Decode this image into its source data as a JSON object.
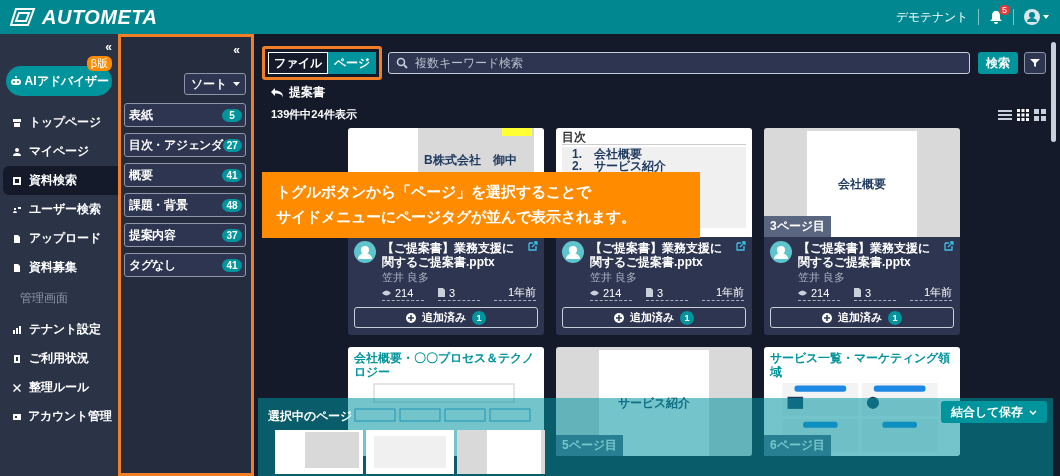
{
  "header": {
    "logo": "AUTOMETA",
    "tenant": "デモテナント",
    "notification_count": "5"
  },
  "sidebar": {
    "collapse": "«",
    "ai_button": "AIアドバイザー",
    "ai_badge": "β版",
    "items": [
      {
        "label": "トップページ",
        "selected": false
      },
      {
        "label": "マイページ",
        "selected": false
      },
      {
        "label": "資料検索",
        "selected": true
      },
      {
        "label": "ユーザー検索",
        "selected": false
      },
      {
        "label": "アップロード",
        "selected": false
      },
      {
        "label": "資料募集",
        "selected": false
      }
    ],
    "section": "管理画面",
    "admin_items": [
      {
        "label": "テナント設定",
        "selected": false
      },
      {
        "label": "ご利用状況",
        "selected": false
      },
      {
        "label": "整理ルール",
        "selected": false
      },
      {
        "label": "アカウント管理",
        "selected": false
      }
    ]
  },
  "tag_panel": {
    "annotated": true,
    "collapse": "«",
    "sort": "ソート",
    "tags": [
      {
        "label": "表紙",
        "count": "5"
      },
      {
        "label": "目次・アジェンダ",
        "count": "27"
      },
      {
        "label": "概要",
        "count": "41"
      },
      {
        "label": "課題・背景",
        "count": "48"
      },
      {
        "label": "提案内容",
        "count": "37"
      },
      {
        "label": "タグなし",
        "count": "41"
      }
    ]
  },
  "toolbar": {
    "annotated": true,
    "toggle": [
      {
        "label": "ファイル",
        "selected": false
      },
      {
        "label": "ページ",
        "selected": true
      }
    ],
    "search": {
      "placeholder": "複数キーワード検索"
    },
    "search_button": "検索"
  },
  "breadcrumb": "提案書",
  "result_count": "139件中24件表示",
  "cards": [
    {
      "slide": {
        "kind": "cover",
        "text": "B株式会社　御中"
      },
      "title": "【ご提案書】業務支援に関するご提案書.pptx",
      "author": "笠井 良多",
      "views": "214",
      "pages": "3",
      "age": "1年前",
      "added": "追加済み",
      "added_count": "1"
    },
    {
      "slide": {
        "kind": "toc",
        "heading": "目次",
        "items": [
          "1.　会社概要",
          "2.　サービス紹介"
        ]
      },
      "title": "【ご提案書】業務支援に関するご提案書.pptx",
      "author": "笠井 良多",
      "views": "214",
      "pages": "3",
      "age": "1年前",
      "added": "追加済み",
      "added_count": "1"
    },
    {
      "slide": {
        "kind": "title",
        "text": "会社概要"
      },
      "page_label": "3ページ目",
      "title": "【ご提案書】業務支援に関するご提案書.pptx",
      "author": "笠井 良多",
      "views": "214",
      "pages": "3",
      "age": "1年前",
      "added": "追加済み",
      "added_count": "1"
    },
    {
      "slide": {
        "kind": "diagram",
        "heading": "会社概要・〇〇プロセス＆テクノロジー"
      }
    },
    {
      "slide": {
        "kind": "title",
        "text": "サービス紹介"
      },
      "page_label": "5ページ目"
    },
    {
      "slide": {
        "kind": "grid",
        "heading": "サービス一覧・マーケティング領域"
      },
      "page_label": "6ページ目"
    }
  ],
  "callout": [
    "トグルボタンから「ページ」を選択することで",
    "サイドメニューにページタグが並んで表示されます。"
  ],
  "selection": {
    "label": "選択中のページ",
    "save_button": "結合して保存",
    "thumbnails": [
      {
        "kind": "cover"
      },
      {
        "kind": "toc"
      },
      {
        "kind": "title"
      }
    ]
  }
}
